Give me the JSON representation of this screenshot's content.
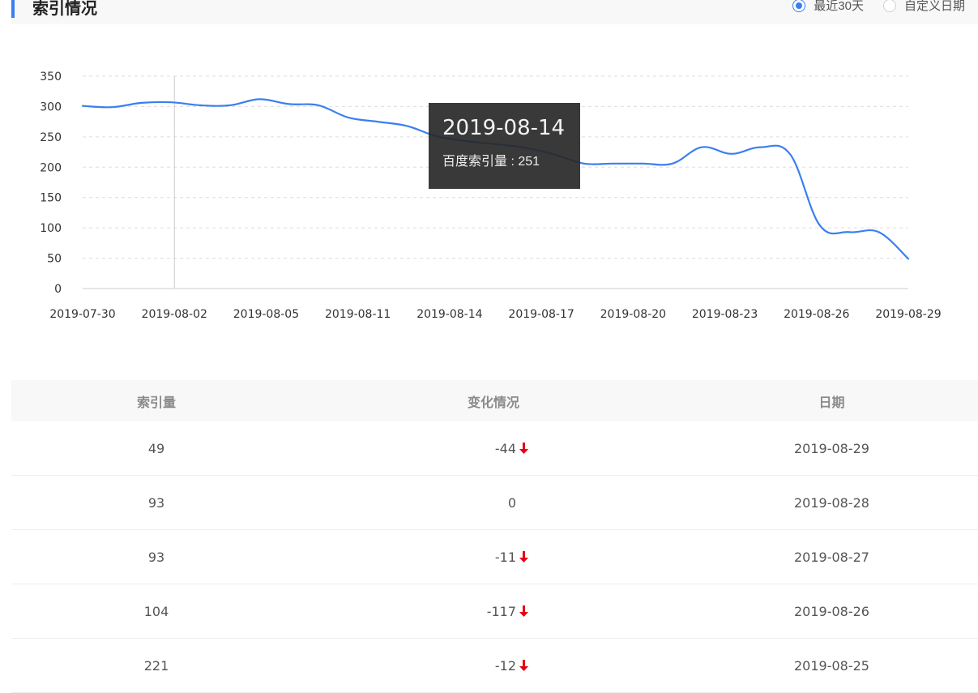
{
  "header": {
    "title": "索引情况",
    "range_options": [
      {
        "label": "最近30天",
        "checked": true
      },
      {
        "label": "自定义日期",
        "checked": false
      }
    ]
  },
  "chart_data": {
    "type": "line",
    "x": [
      "2019-07-30",
      "2019-07-31",
      "2019-08-01",
      "2019-08-02",
      "2019-08-03",
      "2019-08-04",
      "2019-08-05",
      "2019-08-06",
      "2019-08-07",
      "2019-08-08",
      "2019-08-09",
      "2019-08-10",
      "2019-08-11",
      "2019-08-12",
      "2019-08-13",
      "2019-08-14",
      "2019-08-15",
      "2019-08-16",
      "2019-08-17",
      "2019-08-18",
      "2019-08-19",
      "2019-08-20",
      "2019-08-21",
      "2019-08-22",
      "2019-08-23",
      "2019-08-24",
      "2019-08-25",
      "2019-08-26",
      "2019-08-27",
      "2019-08-28",
      "2019-08-29"
    ],
    "x_tick_labels": [
      "2019-07-30",
      "2019-08-02",
      "2019-08-05",
      "2019-08-11",
      "2019-08-14",
      "2019-08-17",
      "2019-08-20",
      "2019-08-23",
      "2019-08-26",
      "2019-08-29"
    ],
    "series": [
      {
        "name": "百度索引量",
        "color": "#3a7ff0",
        "values": [
          301,
          299,
          306,
          307,
          302,
          302,
          312,
          304,
          302,
          282,
          275,
          268,
          251,
          243,
          238,
          232,
          221,
          206,
          206,
          206,
          206,
          233,
          222,
          233,
          221,
          104,
          93,
          93,
          49
        ]
      }
    ],
    "ylim": [
      0,
      350
    ],
    "y_ticks": [
      0,
      50,
      100,
      150,
      200,
      250,
      300,
      350
    ],
    "grid": true,
    "crosshair_at": "2019-08-02",
    "tooltip": {
      "date": "2019-08-14",
      "series_label": "百度索引量",
      "value": 251
    }
  },
  "table": {
    "headers": [
      "索引量",
      "变化情况",
      "日期"
    ],
    "rows": [
      {
        "count": "49",
        "change": "-44",
        "down": true,
        "date": "2019-08-29"
      },
      {
        "count": "93",
        "change": "0",
        "down": false,
        "date": "2019-08-28"
      },
      {
        "count": "93",
        "change": "-11",
        "down": true,
        "date": "2019-08-27"
      },
      {
        "count": "104",
        "change": "-117",
        "down": true,
        "date": "2019-08-26"
      },
      {
        "count": "221",
        "change": "-12",
        "down": true,
        "date": "2019-08-25"
      }
    ],
    "down_color": "#e60012"
  }
}
